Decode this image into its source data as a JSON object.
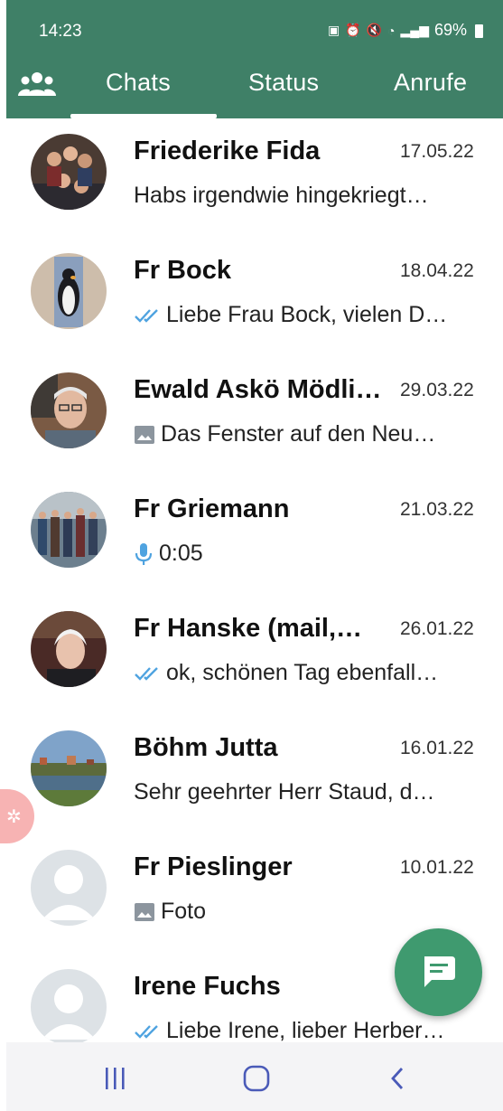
{
  "status_bar": {
    "time": "14:23",
    "battery": "69%"
  },
  "tabs": [
    {
      "label": "Chats",
      "active": true
    },
    {
      "label": "Status",
      "active": false
    },
    {
      "label": "Anrufe",
      "active": false
    }
  ],
  "chats": [
    {
      "name": "Friederike Fida",
      "date": "17.05.22",
      "preview": "Habs irgendwie hingekriegt…",
      "icon": ""
    },
    {
      "name": "Fr Bock",
      "date": "18.04.22",
      "preview": "Liebe Frau Bock, vielen D…",
      "icon": "double-check-icon"
    },
    {
      "name": "Ewald Askö Mödli…",
      "date": "29.03.22",
      "preview": "Das Fenster auf den  Neu…",
      "icon": "photo-icon"
    },
    {
      "name": "Fr Griemann",
      "date": "21.03.22",
      "preview": "0:05",
      "icon": "microphone-icon"
    },
    {
      "name": "Fr Hanske (mail,…",
      "date": "26.01.22",
      "preview": "ok, schönen Tag ebenfall…",
      "icon": "double-check-icon"
    },
    {
      "name": "Böhm Jutta",
      "date": "16.01.22",
      "preview": "Sehr geehrter Herr Staud, d…",
      "icon": ""
    },
    {
      "name": "Fr Pieslinger",
      "date": "10.01.22",
      "preview": "Foto",
      "icon": "photo-icon"
    },
    {
      "name": "Irene Fuchs",
      "date": "",
      "preview": "Liebe Irene, lieber Herber…",
      "icon": "double-check-icon"
    }
  ],
  "colors": {
    "header": "#3f8067",
    "fab": "#3f9a6f",
    "read_check": "#4fa3e0"
  }
}
